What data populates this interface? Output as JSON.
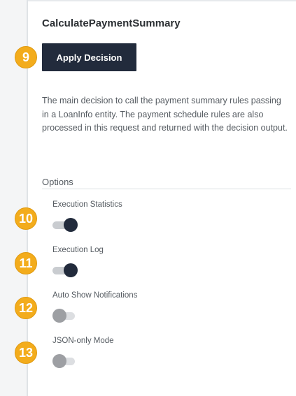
{
  "decision": {
    "title": "CalculatePaymentSummary",
    "apply_label": "Apply Decision",
    "apply_badge": "9",
    "description": "The main decision to call the payment summary rules passing in a LoanInfo entity. The payment schedule rules are also processed in this request and returned with the decision output."
  },
  "options": {
    "heading": "Options",
    "items": [
      {
        "badge": "10",
        "label": "Execution Statistics",
        "enabled": true
      },
      {
        "badge": "11",
        "label": "Execution Log",
        "enabled": true
      },
      {
        "badge": "12",
        "label": "Auto Show Notifications",
        "enabled": false
      },
      {
        "badge": "13",
        "label": "JSON-only Mode",
        "enabled": false
      }
    ]
  },
  "colors": {
    "badge": "#f3ac1c",
    "button": "#222b3c",
    "toggle_on": "#222b3c",
    "toggle_off": "#9d9fa3"
  }
}
